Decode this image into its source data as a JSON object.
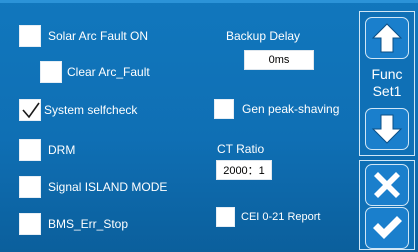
{
  "options": {
    "solar_arc_fault": {
      "label": "Solar Arc Fault ON",
      "checked": false
    },
    "clear_arc_fault": {
      "label": "Clear Arc_Fault",
      "checked": false
    },
    "system_selfcheck": {
      "label": "System selfcheck",
      "checked": true
    },
    "drm": {
      "label": "DRM",
      "checked": false
    },
    "signal_island_mode": {
      "label": "Signal ISLAND MODE",
      "checked": false
    },
    "bms_err_stop": {
      "label": "BMS_Err_Stop",
      "checked": false
    },
    "gen_peak_shaving": {
      "label": "Gen peak-shaving",
      "checked": false
    },
    "cei_report": {
      "label": "CEI 0-21 Report",
      "checked": false
    }
  },
  "backup_delay": {
    "label": "Backup Delay",
    "value": "0ms"
  },
  "ct_ratio": {
    "label": "CT Ratio",
    "value": "2000：1"
  },
  "side": {
    "func_line1": "Func",
    "func_line2": "Set1"
  },
  "colors": {
    "background": "#1177bd",
    "checkbox": "#ffffff",
    "text": "#ffffff"
  },
  "icons": {
    "up": "arrow-up-icon",
    "down": "arrow-down-icon",
    "cancel": "close-icon",
    "confirm": "checkmark-icon"
  }
}
